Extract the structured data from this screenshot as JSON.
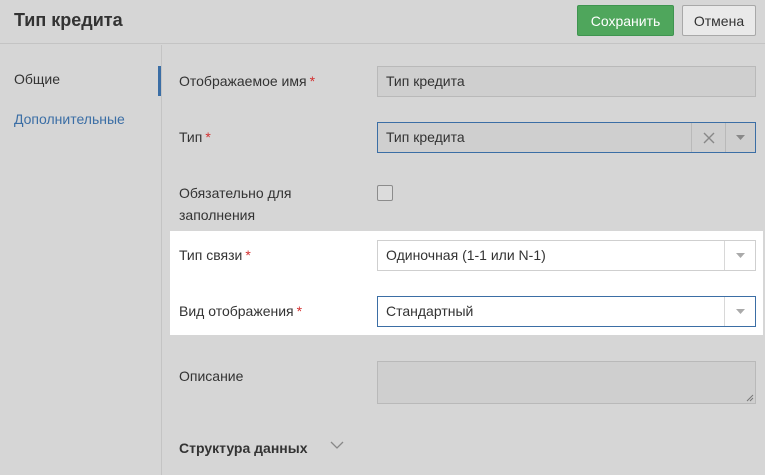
{
  "header": {
    "title": "Тип кредита",
    "save_label": "Сохранить",
    "cancel_label": "Отмена"
  },
  "sidebar": {
    "items": [
      {
        "label": "Общие",
        "active": true
      },
      {
        "label": "Дополнительные",
        "active": false
      }
    ]
  },
  "form": {
    "display_name": {
      "label": "Отображаемое имя",
      "required_mark": "*",
      "value": "Тип кредита"
    },
    "type": {
      "label": "Тип",
      "required_mark": "*",
      "value": "Тип кредита"
    },
    "mandatory": {
      "label_line1": "Обязательно для",
      "label_line2": "заполнения",
      "checked": false
    },
    "link_type": {
      "label": "Тип связи",
      "required_mark": "*",
      "value": "Одиночная (1-1 или N-1)"
    },
    "display_kind": {
      "label": "Вид отображения",
      "required_mark": "*",
      "value": "Стандартный"
    },
    "description": {
      "label": "Описание",
      "value": ""
    }
  },
  "section": {
    "label": "Структура данных"
  },
  "colors": {
    "save_button": "#4fa65c",
    "accent": "#3b6ea5",
    "required": "#d32f2f",
    "background": "#d6d6d6"
  },
  "icons": [
    "close-icon",
    "chevron-down-icon",
    "resize-grip-icon"
  ]
}
